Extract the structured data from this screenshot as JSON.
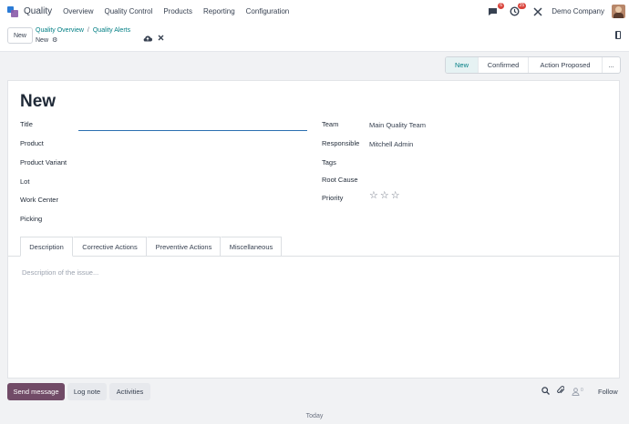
{
  "navbar": {
    "app_name": "Quality",
    "menu": [
      "Overview",
      "Quality Control",
      "Products",
      "Reporting",
      "Configuration"
    ],
    "messages_badge": "6",
    "activities_badge": "25",
    "company": "Demo Company"
  },
  "control": {
    "new_label": "New",
    "breadcrumb": [
      "Quality Overview",
      "Quality Alerts"
    ],
    "breadcrumb_sep": "/",
    "record_name": "New"
  },
  "statusbar": {
    "stages": [
      "New",
      "Confirmed",
      "Action Proposed",
      "..."
    ],
    "active": "New"
  },
  "form": {
    "record_title": "New",
    "left_fields": [
      "Title",
      "Product",
      "Product Variant",
      "Lot",
      "Work Center",
      "Picking"
    ],
    "right_fields": {
      "team_label": "Team",
      "team_value": "Main Quality Team",
      "responsible_label": "Responsible",
      "responsible_value": "Mitchell Admin",
      "tags_label": "Tags",
      "root_cause_label": "Root Cause",
      "priority_label": "Priority",
      "priority_stars": 0
    },
    "tabs": [
      "Description",
      "Corrective Actions",
      "Preventive Actions",
      "Miscellaneous"
    ],
    "description_placeholder": "Description of the issue..."
  },
  "chatter": {
    "send_message": "Send message",
    "log_note": "Log note",
    "activities": "Activities",
    "followers_count": "0",
    "follow": "Follow",
    "date_separator": "Today"
  },
  "colors": {
    "brand": "#714b67",
    "link": "#017e84",
    "badge": "#d9453d"
  }
}
